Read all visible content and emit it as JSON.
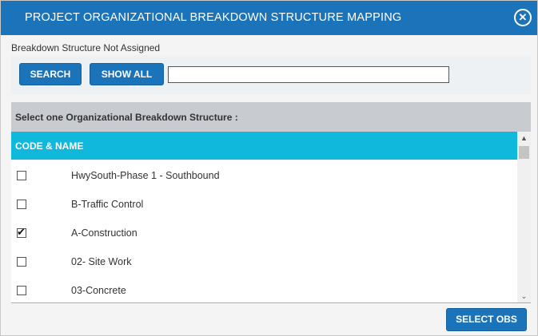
{
  "dialog": {
    "title": "PROJECT ORGANIZATIONAL BREAKDOWN STRUCTURE MAPPING",
    "close_icon": "⨂",
    "status": "Breakdown Structure Not Assigned"
  },
  "search": {
    "search_label": "SEARCH",
    "showall_label": "SHOW ALL",
    "value": ""
  },
  "panel": {
    "heading": "Select one Organizational Breakdown Structure :",
    "column_header": "CODE & NAME",
    "rows": [
      {
        "label": "HwySouth-Phase 1 - Southbound",
        "checked": false
      },
      {
        "label": "B-Traffic Control",
        "checked": false
      },
      {
        "label": "A-Construction",
        "checked": true
      },
      {
        "label": "02- Site Work",
        "checked": false
      },
      {
        "label": "03-Concrete",
        "checked": false
      }
    ],
    "scroll_up": "▲",
    "scroll_down": "˅"
  },
  "footer": {
    "select_label": "SELECT OBS"
  },
  "colors": {
    "titlebar": "#1b73b9",
    "column_header": "#10b8dc",
    "button": "#1b73b9"
  }
}
